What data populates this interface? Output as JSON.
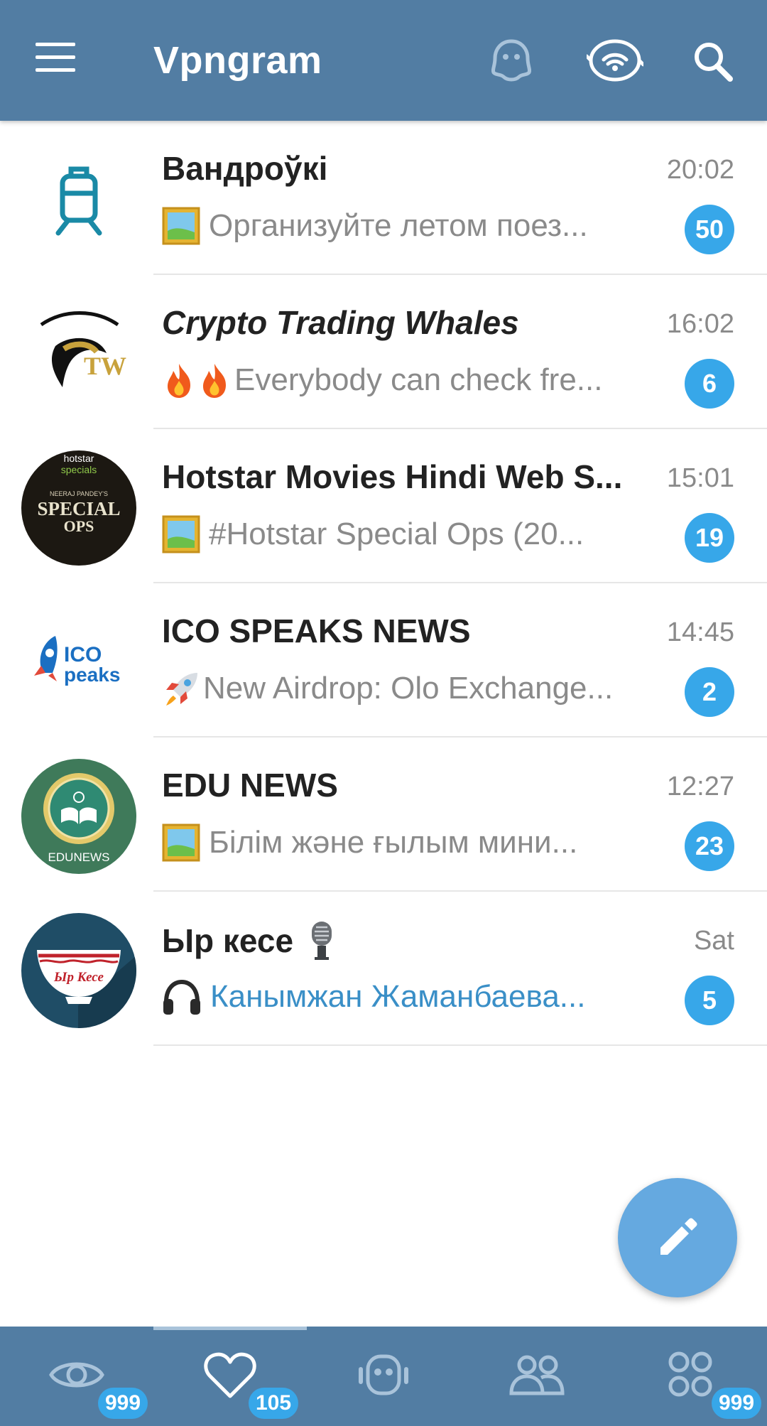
{
  "app_bar": {
    "title": "Vpngram",
    "icons": [
      "menu-icon",
      "ghost-icon",
      "vpn-eye-icon",
      "search-icon"
    ]
  },
  "chats": [
    {
      "title": "Вандроўкі",
      "time": "20:02",
      "preview_icon": "picture-icon",
      "preview": "Организуйте летом поез...",
      "unread": "50",
      "avatar": "train-luggage-avatar"
    },
    {
      "title": "Crypto Trading Whales",
      "time": "16:02",
      "preview_icon": "fire-fire-icon",
      "preview": "Everybody can check fre...",
      "unread": "6",
      "avatar": "ctw-whale-logo"
    },
    {
      "title": "Hotstar Movies Hindi Web S...",
      "time": "15:01",
      "preview_icon": "picture-icon",
      "preview": "#Hotstar Special Ops (20...",
      "unread": "19",
      "avatar": "special-ops-avatar",
      "avatar_text": {
        "brand": "hotstar",
        "brand2": "specials",
        "byline": "NEERAJ PANDEY'S",
        "line1": "SPECIAL",
        "line2": "OPS"
      }
    },
    {
      "title": "ICO SPEAKS NEWS",
      "time": "14:45",
      "preview_icon": "rocket-icon",
      "preview": "New Airdrop: Olo Exchange...",
      "unread": "2",
      "avatar": "ico-speaks-logo",
      "avatar_text": {
        "line1": "ICO",
        "line2": "peaks"
      }
    },
    {
      "title": "EDU NEWS",
      "time": "12:27",
      "preview_icon": "picture-icon",
      "preview": "Білім және ғылым мини...",
      "unread": "23",
      "avatar": "edu-news-emblem",
      "avatar_text": {
        "line1": "EDUNEWS"
      }
    },
    {
      "title": "Ыр кесе",
      "title_icon": "microphone-icon",
      "time": "Sat",
      "preview_icon": "headphones-icon",
      "preview": "Канымжан Жаманбаева...",
      "unread": "5",
      "avatar": "bowl-avatar",
      "avatar_text": {
        "line1": "Ыр Кесе"
      }
    }
  ],
  "fab": {
    "icon": "pencil-icon"
  },
  "bottom_tabs": [
    {
      "icon": "eye-icon",
      "badge": "999",
      "active": false
    },
    {
      "icon": "heart-icon",
      "badge": "105",
      "active": true
    },
    {
      "icon": "bot-icon",
      "badge": "",
      "active": false
    },
    {
      "icon": "people-icon",
      "badge": "",
      "active": false
    },
    {
      "icon": "grid-icon",
      "badge": "999",
      "active": false
    }
  ],
  "colors": {
    "bar": "#527da3",
    "badge": "#37a7e9",
    "fab": "#65a9e0",
    "link_blue": "#3a8fc7"
  }
}
